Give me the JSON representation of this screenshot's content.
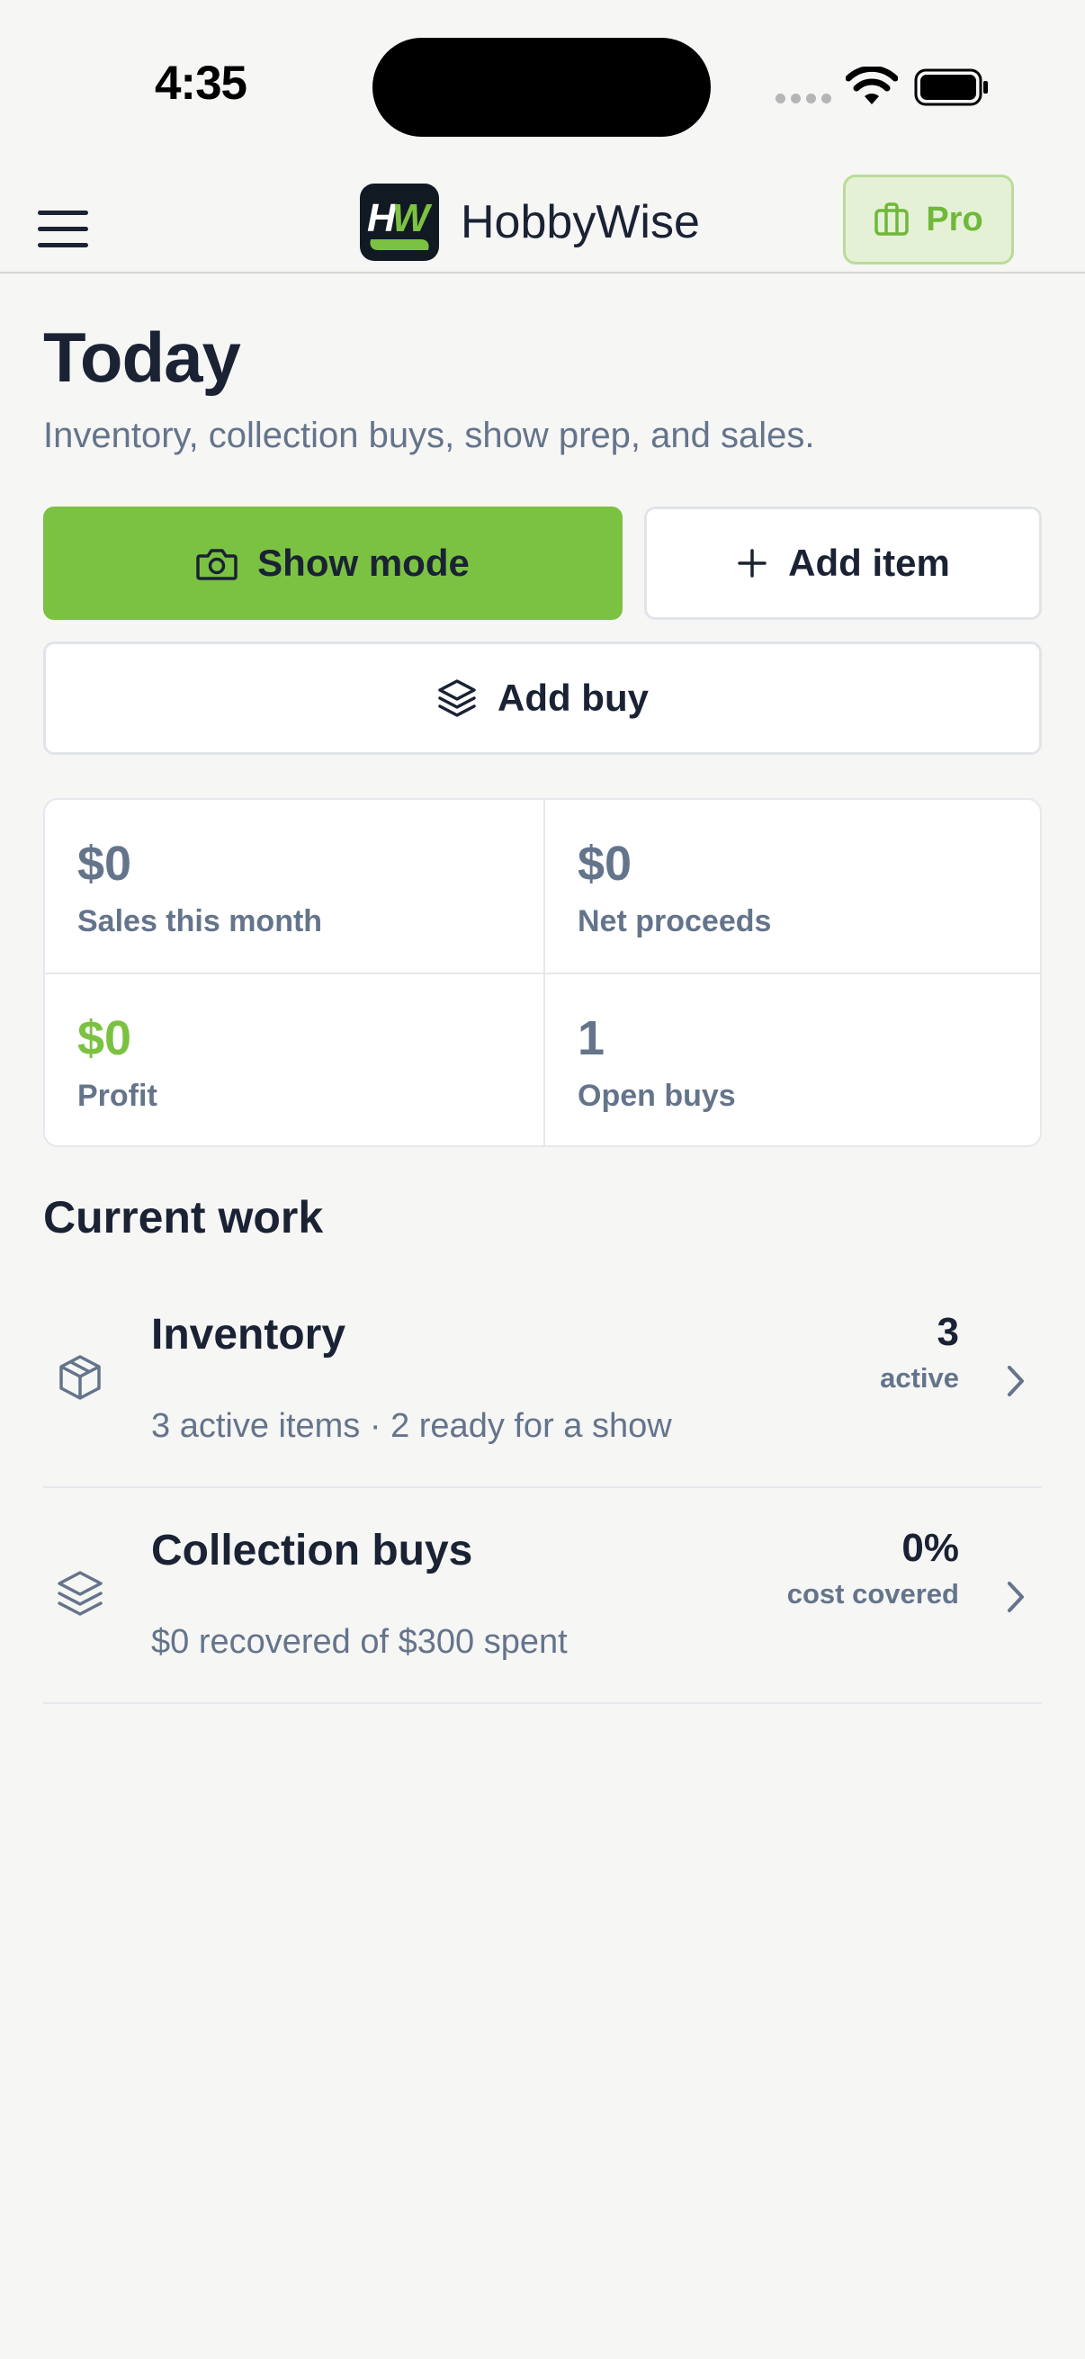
{
  "status_bar": {
    "time": "4:35"
  },
  "header": {
    "app_name": "HobbyWise",
    "logo_text": "HW",
    "pro_label": "Pro"
  },
  "main": {
    "title": "Today",
    "subtitle": "Inventory, collection buys, show prep, and sales.",
    "actions": {
      "show_mode": "Show mode",
      "add_item": "Add item",
      "add_buy": "Add buy"
    },
    "stats": [
      {
        "value": "$0",
        "label": "Sales this month"
      },
      {
        "value": "$0",
        "label": "Net proceeds"
      },
      {
        "value": "$0",
        "label": "Profit"
      },
      {
        "value": "1",
        "label": "Open buys"
      }
    ],
    "current_work": {
      "title": "Current work",
      "items": [
        {
          "title": "Inventory",
          "description": "3 active items · 2 ready for a show",
          "metric": "3",
          "metric_label": "active"
        },
        {
          "title": "Collection buys",
          "description": "$0 recovered of $300 spent",
          "metric": "0%",
          "metric_label": "cost covered"
        }
      ]
    }
  },
  "colors": {
    "accent_green": "#7cc242",
    "text_dark": "#1a2234",
    "text_muted": "#64748b",
    "background": "#f6f6f5"
  },
  "icons": {
    "menu": "hamburger-menu-icon",
    "pro": "briefcase-icon",
    "show_mode": "camera-icon",
    "add_item": "plus-icon",
    "add_buy": "layers-icon",
    "inventory": "box-icon",
    "collection_buys": "layers-icon",
    "row_chevron": "chevron-right-icon"
  }
}
